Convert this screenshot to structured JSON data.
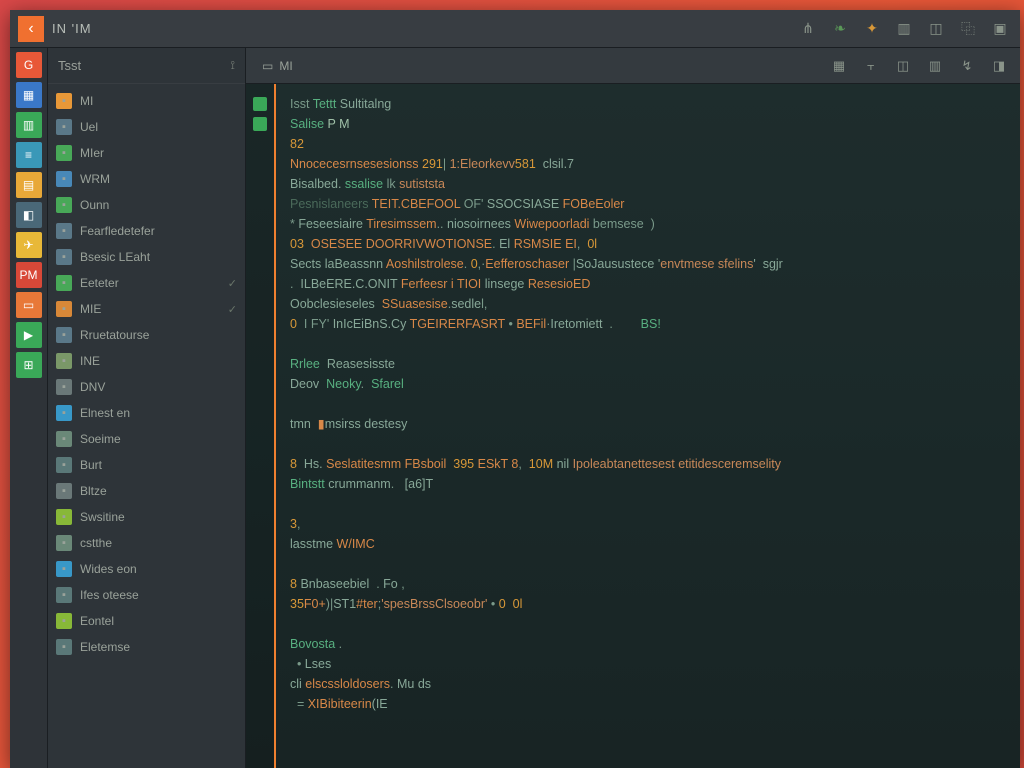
{
  "titlebar": {
    "title": "IN  'IM",
    "back_glyph": "‹",
    "icons": [
      "share-icon",
      "leaf-icon",
      "star-icon",
      "panel-icon",
      "layout-icon",
      "graph-icon",
      "close-icon"
    ]
  },
  "strip": [
    {
      "name": "logo-g",
      "bg": "#e85838",
      "glyph": "G"
    },
    {
      "name": "doc-icon",
      "bg": "#3a78c8",
      "glyph": "▦"
    },
    {
      "name": "chip-icon",
      "bg": "#3aa858",
      "glyph": "▥"
    },
    {
      "name": "db-icon",
      "bg": "#3a98b8",
      "glyph": "≡"
    },
    {
      "name": "grid-icon",
      "bg": "#e8a838",
      "glyph": "▤"
    },
    {
      "name": "box-icon",
      "bg": "#4a6878",
      "glyph": "◧"
    },
    {
      "name": "plane-icon",
      "bg": "#e8b838",
      "glyph": "✈"
    },
    {
      "name": "tag-pm",
      "bg": "#d84838",
      "glyph": "PM"
    },
    {
      "name": "file-icon",
      "bg": "#e87838",
      "glyph": "▭"
    },
    {
      "name": "play-icon",
      "bg": "#3aa858",
      "glyph": "▶"
    },
    {
      "name": "table-icon",
      "bg": "#3aa858",
      "glyph": "⊞"
    }
  ],
  "sidebar": {
    "header": "Tsst",
    "items": [
      {
        "icon": "folder-icon",
        "color": "#e89838",
        "label": "MI",
        "check": false
      },
      {
        "icon": "file-icon",
        "color": "#5a7888",
        "label": "Uel",
        "check": false
      },
      {
        "icon": "file-icon",
        "color": "#48a858",
        "label": "MIer",
        "check": false
      },
      {
        "icon": "file-icon",
        "color": "#4888b8",
        "label": "WRM",
        "check": false
      },
      {
        "icon": "file-icon",
        "color": "#48a858",
        "label": "Ounn",
        "check": false
      },
      {
        "icon": "module-icon",
        "color": "#5a7888",
        "label": "Fearfledetefer",
        "check": false
      },
      {
        "icon": "module-icon",
        "color": "#5a7888",
        "label": "Bsesic LEaht",
        "check": false
      },
      {
        "icon": "chart-icon",
        "color": "#48a858",
        "label": "Eeteter",
        "check": true
      },
      {
        "icon": "file-icon",
        "color": "#d88838",
        "label": "MIE",
        "check": true
      },
      {
        "icon": "module-icon",
        "color": "#5a7888",
        "label": "Rruetatourse",
        "check": false
      },
      {
        "icon": "wave-icon",
        "color": "#7a9868",
        "label": "INE",
        "check": false
      },
      {
        "icon": "tool-icon",
        "color": "#6a7878",
        "label": "DNV",
        "check": false
      },
      {
        "icon": "panel-icon",
        "color": "#3898c8",
        "label": "Elnest en",
        "check": false
      },
      {
        "icon": "gear-icon",
        "color": "#6a8878",
        "label": "Soeime",
        "check": false
      },
      {
        "icon": "term-icon",
        "color": "#5a7878",
        "label": "Burt",
        "check": false
      },
      {
        "icon": "layout-icon",
        "color": "#6a7878",
        "label": "Bltze",
        "check": false
      },
      {
        "icon": "square-icon",
        "color": "#88b838",
        "label": "Swsitine",
        "check": false
      },
      {
        "icon": "wrench-icon",
        "color": "#6a8878",
        "label": "cstthe",
        "check": false
      },
      {
        "icon": "box-icon",
        "color": "#3898c8",
        "label": "Wides eon",
        "check": false
      },
      {
        "icon": "list-icon",
        "color": "#5a7878",
        "label": "Ifes oteese",
        "check": false
      },
      {
        "icon": "bars-icon",
        "color": "#88b838",
        "label": "Eontel",
        "check": false
      },
      {
        "icon": "page-icon",
        "color": "#5a7878",
        "label": "Eletemse",
        "check": false
      }
    ]
  },
  "toolbar": {
    "tab_glyph": "▭",
    "tab_label": "MI",
    "icons": [
      "panel-icon",
      "split-icon",
      "layout-icon",
      "columns-icon",
      "wrench-icon",
      "side-icon"
    ]
  },
  "gutter_markers": [
    {
      "color": "#3aa858"
    },
    {
      "color": "#3aa858"
    }
  ],
  "code": [
    [
      {
        "c": "pl",
        "t": "Isst "
      },
      {
        "c": "kw",
        "t": "Tettt "
      },
      {
        "c": "id",
        "t": "Sultitalng"
      }
    ],
    [
      {
        "c": "kw",
        "t": "Salise "
      },
      {
        "c": "hl",
        "t": "P M"
      }
    ],
    [
      {
        "c": "num",
        "t": "82"
      }
    ],
    [
      {
        "c": "fn",
        "t": "Nnocecesrnsesesionss "
      },
      {
        "c": "num",
        "t": "291"
      },
      {
        "c": "pl",
        "t": "| "
      },
      {
        "c": "str",
        "t": "1:Eleorkevv"
      },
      {
        "c": "num",
        "t": "581  "
      },
      {
        "c": "id",
        "t": "clsil.7"
      }
    ],
    [
      {
        "c": "id",
        "t": "Bisalbed. "
      },
      {
        "c": "kw",
        "t": "ssalise "
      },
      {
        "c": "pl",
        "t": "lk "
      },
      {
        "c": "str",
        "t": "sutiststa"
      }
    ],
    [
      {
        "c": "cm",
        "t": "Pesnislaneers "
      },
      {
        "c": "fn",
        "t": "TEIT.CBEFOOL "
      },
      {
        "c": "pl",
        "t": "OF' "
      },
      {
        "c": "id",
        "t": "SSOCSIASE "
      },
      {
        "c": "fn",
        "t": "FOBeEoler"
      }
    ],
    [
      {
        "c": "pl",
        "t": "* "
      },
      {
        "c": "id",
        "t": "Feseesiaire "
      },
      {
        "c": "fn",
        "t": "Tiresimssem"
      },
      {
        "c": "pl",
        "t": ".. "
      },
      {
        "c": "id",
        "t": "niosoirnees "
      },
      {
        "c": "fn",
        "t": "Wiwepoorladi "
      },
      {
        "c": "pl",
        "t": "bemsese  )"
      }
    ],
    [
      {
        "c": "num",
        "t": "03  "
      },
      {
        "c": "fn",
        "t": "OSESEE DOORRIVWOTIONSE"
      },
      {
        "c": "pl",
        "t": ". "
      },
      {
        "c": "id",
        "t": "El "
      },
      {
        "c": "fn",
        "t": "RSMSIE EI"
      },
      {
        "c": "pl",
        "t": ",  "
      },
      {
        "c": "num",
        "t": "0l"
      }
    ],
    [
      {
        "c": "id",
        "t": "Sects laBeassnn "
      },
      {
        "c": "fn",
        "t": "Aoshilstrolese"
      },
      {
        "c": "pl",
        "t": ". "
      },
      {
        "c": "num",
        "t": "0"
      },
      {
        "c": "pl",
        "t": ",·"
      },
      {
        "c": "fn",
        "t": "Eefferoschaser "
      },
      {
        "c": "pl",
        "t": "|"
      },
      {
        "c": "id",
        "t": "SoJausustece '"
      },
      {
        "c": "str",
        "t": "envtmese sfelins"
      },
      {
        "c": "id",
        "t": "'  sgjr"
      }
    ],
    [
      {
        "c": "pl",
        "t": ".  "
      },
      {
        "c": "id",
        "t": "ILBeERE.C.ONIT "
      },
      {
        "c": "fn",
        "t": "Ferfeesr i TIOI "
      },
      {
        "c": "id",
        "t": "linsege "
      },
      {
        "c": "fn",
        "t": "ResesioED"
      }
    ],
    [
      {
        "c": "id",
        "t": "Oobclesieseles  "
      },
      {
        "c": "fn",
        "t": "SSuasesise"
      },
      {
        "c": "pl",
        "t": "."
      },
      {
        "c": "id",
        "t": "sedle"
      },
      {
        "c": "pl",
        "t": "l,"
      }
    ],
    [
      {
        "c": "num",
        "t": "0  "
      },
      {
        "c": "pl",
        "t": "I FY' "
      },
      {
        "c": "id",
        "t": "InIcEiBnS.Cy "
      },
      {
        "c": "fn",
        "t": "TGEIRERFASRT "
      },
      {
        "c": "pl",
        "t": "• "
      },
      {
        "c": "fn",
        "t": "BEFil"
      },
      {
        "c": "pl",
        "t": "·"
      },
      {
        "c": "id",
        "t": "Iretomiett  "
      },
      {
        "c": "pl",
        "t": ".        "
      },
      {
        "c": "kw",
        "t": "BS!"
      }
    ],
    [],
    [
      {
        "c": "kw",
        "t": "Rrlee  "
      },
      {
        "c": "id",
        "t": "Reasesisste"
      }
    ],
    [
      {
        "c": "id",
        "t": "Deov  "
      },
      {
        "c": "kw",
        "t": "Neoky"
      },
      {
        "c": "pl",
        "t": ".  "
      },
      {
        "c": "kw",
        "t": "Sfarel"
      }
    ],
    [],
    [
      {
        "c": "id",
        "t": "tmn  "
      },
      {
        "c": "fn",
        "t": "▮"
      },
      {
        "c": "id",
        "t": "msirss destesy"
      }
    ],
    [],
    [
      {
        "c": "num",
        "t": "8  "
      },
      {
        "c": "id",
        "t": "Hs. "
      },
      {
        "c": "fn",
        "t": "Seslatitesmm FBsboil  "
      },
      {
        "c": "num",
        "t": "395 "
      },
      {
        "c": "fn",
        "t": "ESkT 8"
      },
      {
        "c": "pl",
        "t": ",  "
      },
      {
        "c": "num",
        "t": "10M "
      },
      {
        "c": "id",
        "t": "nil "
      },
      {
        "c": "str",
        "t": "Ipoleabtanettesest etitidesceremselity"
      }
    ],
    [
      {
        "c": "kw",
        "t": "Bintstt "
      },
      {
        "c": "id",
        "t": "crummanm"
      },
      {
        "c": "pl",
        "t": ".   "
      },
      {
        "c": "id",
        "t": "[a6]T"
      }
    ],
    [],
    [
      {
        "c": "num",
        "t": "3"
      },
      {
        "c": "pl",
        "t": ","
      }
    ],
    [
      {
        "c": "id",
        "t": "lasstme "
      },
      {
        "c": "fn",
        "t": "W/IMC"
      }
    ],
    [],
    [
      {
        "c": "num",
        "t": "8 "
      },
      {
        "c": "id",
        "t": "Bnbaseebiel "
      },
      {
        "c": "pl",
        "t": " . "
      },
      {
        "c": "id",
        "t": "Fo "
      },
      {
        "c": "pl",
        "t": ","
      }
    ],
    [
      {
        "c": "num",
        "t": "35"
      },
      {
        "c": "fn",
        "t": "F0+"
      },
      {
        "c": "pl",
        "t": ")|"
      },
      {
        "c": "id",
        "t": "ST1"
      },
      {
        "c": "fn",
        "t": "#ter"
      },
      {
        "c": "pl",
        "t": ";"
      },
      {
        "c": "str",
        "t": "'spesBrssClsoeobr'"
      },
      {
        "c": "pl",
        "t": " • "
      },
      {
        "c": "num",
        "t": "0  0l"
      }
    ],
    [],
    [
      {
        "c": "kw",
        "t": "Bovosta "
      },
      {
        "c": "pl",
        "t": "."
      }
    ],
    [
      {
        "c": "pl",
        "t": "  • "
      },
      {
        "c": "id",
        "t": "Lses"
      }
    ],
    [
      {
        "c": "id",
        "t": "cli "
      },
      {
        "c": "fn",
        "t": "elscssloldosers"
      },
      {
        "c": "pl",
        "t": ". "
      },
      {
        "c": "id",
        "t": "Mu ds"
      }
    ],
    [
      {
        "c": "pl",
        "t": "  = "
      },
      {
        "c": "fn",
        "t": "XIBibiteerin"
      },
      {
        "c": "id",
        "t": "(IE"
      }
    ]
  ]
}
